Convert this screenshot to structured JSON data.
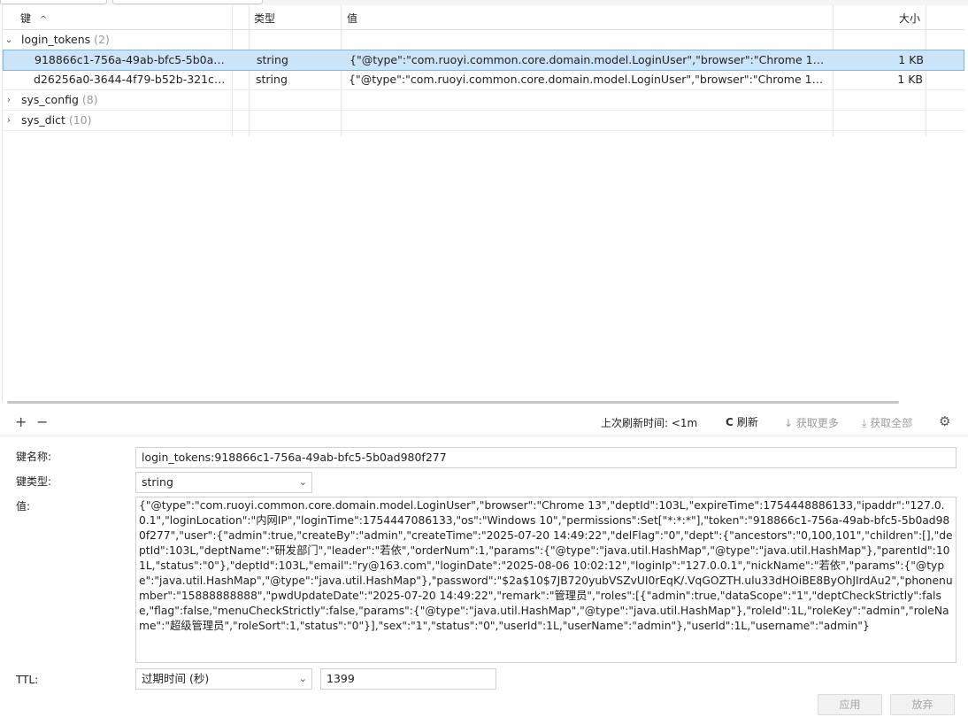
{
  "table": {
    "columns": {
      "key": "键",
      "key_sort": "^",
      "type": "类型",
      "value": "值",
      "size": "大小"
    },
    "groups": [
      {
        "name": "login_tokens",
        "count": "(2)",
        "expanded": true
      },
      {
        "name": "sys_config",
        "count": "(8)",
        "expanded": false
      },
      {
        "name": "sys_dict",
        "count": "(10)",
        "expanded": false
      }
    ],
    "rows": [
      {
        "key": "918866c1-756a-49ab-bfc5-5b0ad98...",
        "type": "string",
        "value": "{\"@type\":\"com.ruoyi.common.core.domain.model.LoginUser\",\"browser\":\"Chrome 13\",\"deptI...",
        "size": "1 KB"
      },
      {
        "key": "d26256a0-3644-4f79-b52b-321c3d0...",
        "type": "string",
        "value": "{\"@type\":\"com.ruoyi.common.core.domain.model.LoginUser\",\"browser\":\"Chrome 13\",\"deptI...",
        "size": "1 KB"
      }
    ]
  },
  "toolbar": {
    "add": "+",
    "remove": "−",
    "last_refresh": "上次刷新时间: <1m",
    "refresh_icon": "C",
    "refresh": "刷新",
    "more_icon": "↓",
    "more": "获取更多",
    "all_icon": "⤓",
    "all": "获取全部",
    "settings_icon": "⚙"
  },
  "form": {
    "key_name_label": "键名称:",
    "key_name_value": "login_tokens:918866c1-756a-49ab-bfc5-5b0ad980f277",
    "key_type_label": "键类型:",
    "key_type_value": "string",
    "value_label": "值:",
    "value_text": "{\"@type\":\"com.ruoyi.common.core.domain.model.LoginUser\",\"browser\":\"Chrome 13\",\"deptId\":103L,\"expireTime\":1754448886133,\"ipaddr\":\"127.0.0.1\",\"loginLocation\":\"内网IP\",\"loginTime\":1754447086133,\"os\":\"Windows 10\",\"permissions\":Set[\"*:*:*\"],\"token\":\"918866c1-756a-49ab-bfc5-5b0ad980f277\",\"user\":{\"admin\":true,\"createBy\":\"admin\",\"createTime\":\"2025-07-20 14:49:22\",\"delFlag\":\"0\",\"dept\":{\"ancestors\":\"0,100,101\",\"children\":[],\"deptId\":103L,\"deptName\":\"研发部门\",\"leader\":\"若依\",\"orderNum\":1,\"params\":{\"@type\":\"java.util.HashMap\",\"@type\":\"java.util.HashMap\"},\"parentId\":101L,\"status\":\"0\"},\"deptId\":103L,\"email\":\"ry@163.com\",\"loginDate\":\"2025-08-06 10:02:12\",\"loginIp\":\"127.0.0.1\",\"nickName\":\"若依\",\"params\":{\"@type\":\"java.util.HashMap\",\"@type\":\"java.util.HashMap\"},\"password\":\"$2a$10$7JB720yubVSZvUI0rEqK/.VqGOZTH.ulu33dHOiBE8ByOhJIrdAu2\",\"phonenumber\":\"15888888888\",\"pwdUpdateDate\":\"2025-07-20 14:49:22\",\"remark\":\"管理员\",\"roles\":[{\"admin\":true,\"dataScope\":\"1\",\"deptCheckStrictly\":false,\"flag\":false,\"menuCheckStrictly\":false,\"params\":{\"@type\":\"java.util.HashMap\",\"@type\":\"java.util.HashMap\"},\"roleId\":1L,\"roleKey\":\"admin\",\"roleName\":\"超级管理员\",\"roleSort\":1,\"status\":\"0\"}],\"sex\":\"1\",\"status\":\"0\",\"userId\":1L,\"userName\":\"admin\"},\"userId\":1L,\"username\":\"admin\"}",
    "ttl_label": "TTL:",
    "ttl_unit": "过期时间 (秒)",
    "ttl_value": "1399",
    "apply": "应用",
    "discard": "放弃"
  },
  "colors": {
    "selected_row_bg": "#cce4f7",
    "selected_row_border": "#7ab8e8"
  }
}
